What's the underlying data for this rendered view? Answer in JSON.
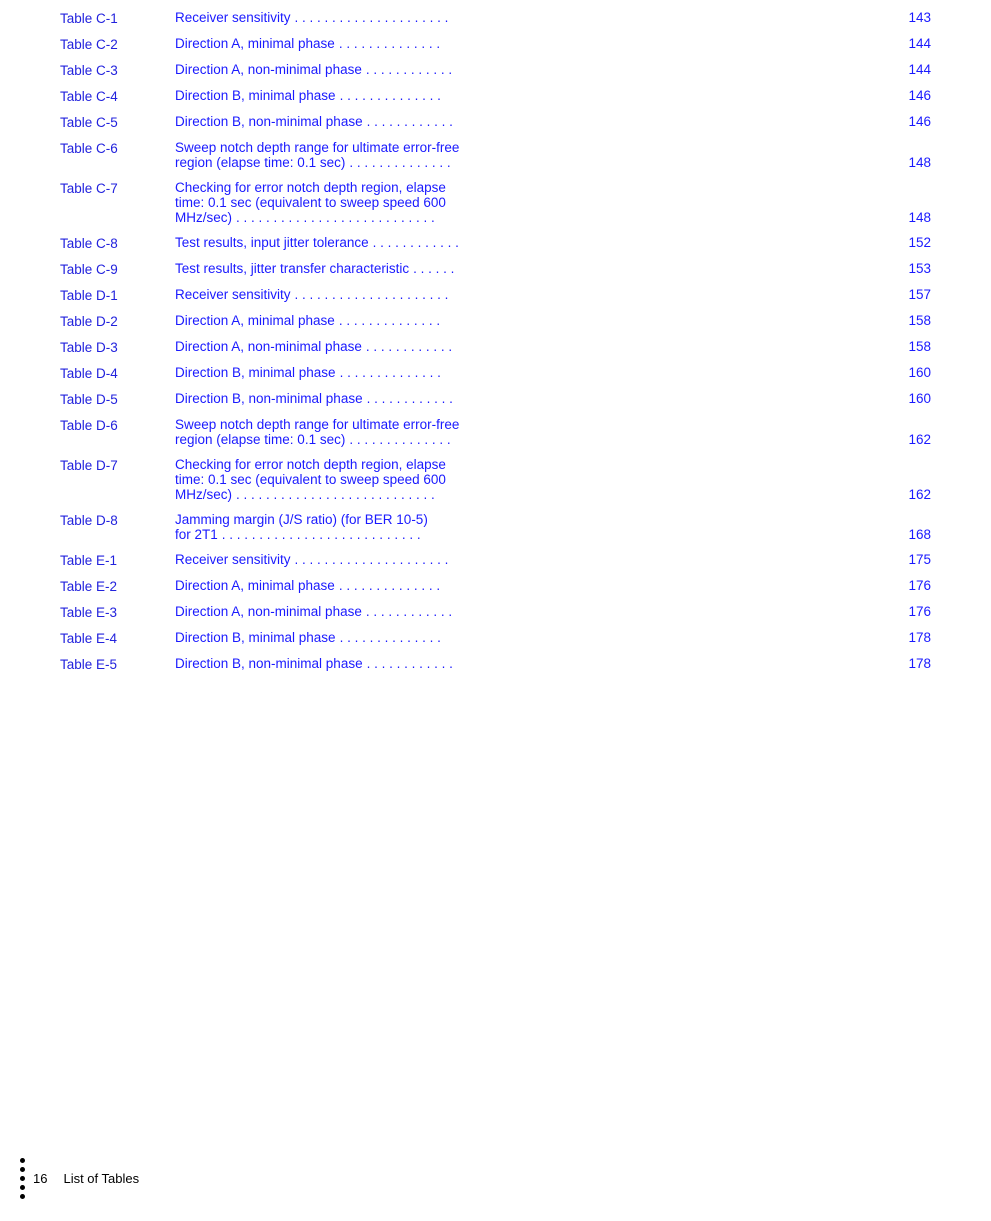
{
  "toc": {
    "entries": [
      {
        "id": "table-c-1",
        "label": "Table C-1",
        "title": "Receiver sensitivity",
        "dots": ". . . . . . . . . . . . . . . . . . . . .",
        "page": "143",
        "multiline": false
      },
      {
        "id": "table-c-2",
        "label": "Table C-2",
        "title": "Direction A, minimal phase",
        "dots": ". . . . . . . . . . . . . .",
        "page": "144",
        "multiline": false
      },
      {
        "id": "table-c-3",
        "label": "Table C-3",
        "title": "Direction A, non-minimal phase",
        "dots": ". . . . . . . . . . . .",
        "page": "144",
        "multiline": false
      },
      {
        "id": "table-c-4",
        "label": "Table C-4",
        "title": "Direction B, minimal phase",
        "dots": ". . . . . . . . . . . . . .",
        "page": "146",
        "multiline": false
      },
      {
        "id": "table-c-5",
        "label": "Table C-5",
        "title": "Direction B, non-minimal phase",
        "dots": ". . . . . . . . . . . .",
        "page": "146",
        "multiline": false
      },
      {
        "id": "table-c-6",
        "label": "Table C-6",
        "title_line1": "Sweep notch depth range for ultimate error-free",
        "title_line2": "region (elapse time: 0.1 sec)",
        "dots": ". . . . . . . . . . . . . .",
        "page": "148",
        "multiline": true
      },
      {
        "id": "table-c-7",
        "label": "Table C-7",
        "title_line1": "Checking for error notch depth region, elapse",
        "title_line2": "time: 0.1 sec (equivalent to sweep speed 600",
        "title_line3": "MHz/sec)",
        "dots": ". . . . . . . . . . . . . . . . . . . . . . . . . . .",
        "page": "148",
        "multiline": true,
        "lines": 3
      },
      {
        "id": "table-c-8",
        "label": "Table C-8",
        "title": "Test results, input jitter tolerance",
        "dots": ". . . . . . . . . . . .",
        "page": "152",
        "multiline": false
      },
      {
        "id": "table-c-9",
        "label": "Table C-9",
        "title": "Test results, jitter transfer characteristic",
        "dots": ". . . . . .",
        "page": "153",
        "multiline": false
      },
      {
        "id": "table-d-1",
        "label": "Table D-1",
        "title": "Receiver sensitivity",
        "dots": ". . . . . . . . . . . . . . . . . . . . .",
        "page": "157",
        "multiline": false
      },
      {
        "id": "table-d-2",
        "label": "Table D-2",
        "title": "Direction A, minimal phase",
        "dots": ". . . . . . . . . . . . . .",
        "page": "158",
        "multiline": false
      },
      {
        "id": "table-d-3",
        "label": "Table D-3",
        "title": "Direction A, non-minimal phase",
        "dots": ". . . . . . . . . . . .",
        "page": "158",
        "multiline": false
      },
      {
        "id": "table-d-4",
        "label": "Table D-4",
        "title": "Direction B, minimal phase",
        "dots": ". . . . . . . . . . . . . .",
        "page": "160",
        "multiline": false
      },
      {
        "id": "table-d-5",
        "label": "Table D-5",
        "title": "Direction B, non-minimal phase",
        "dots": ". . . . . . . . . . . .",
        "page": "160",
        "multiline": false
      },
      {
        "id": "table-d-6",
        "label": "Table D-6",
        "title_line1": "Sweep notch depth range for ultimate error-free",
        "title_line2": "region (elapse time: 0.1 sec)",
        "dots": ". . . . . . . . . . . . . .",
        "page": "162",
        "multiline": true
      },
      {
        "id": "table-d-7",
        "label": "Table D-7",
        "title_line1": "Checking for error notch depth region, elapse",
        "title_line2": "time: 0.1 sec (equivalent to sweep speed 600",
        "title_line3": "MHz/sec)",
        "dots": ". . . . . . . . . . . . . . . . . . . . . . . . . . .",
        "page": "162",
        "multiline": true,
        "lines": 3
      },
      {
        "id": "table-d-8",
        "label": "Table D-8",
        "title_line1": "Jamming margin (J/S ratio) (for BER 10-5)",
        "title_line2": "for 2T1",
        "dots": ". . . . . . . . . . . . . . . . . . . . . . . . . . .",
        "page": "168",
        "multiline": true
      },
      {
        "id": "table-e-1",
        "label": "Table E-1",
        "title": "Receiver sensitivity",
        "dots": ". . . . . . . . . . . . . . . . . . . . .",
        "page": "175",
        "multiline": false
      },
      {
        "id": "table-e-2",
        "label": "Table E-2",
        "title": "Direction A, minimal phase",
        "dots": ". . . . . . . . . . . . . .",
        "page": "176",
        "multiline": false
      },
      {
        "id": "table-e-3",
        "label": "Table E-3",
        "title": "Direction A, non-minimal phase",
        "dots": ". . . . . . . . . . . .",
        "page": "176",
        "multiline": false
      },
      {
        "id": "table-e-4",
        "label": "Table E-4",
        "title": "Direction B, minimal phase",
        "dots": ". . . . . . . . . . . . . .",
        "page": "178",
        "multiline": false
      },
      {
        "id": "table-e-5",
        "label": "Table E-5",
        "title": "Direction B, non-minimal phase",
        "dots": ". . . . . . . . . . . .",
        "page": "178",
        "multiline": false
      }
    ]
  },
  "footer": {
    "page_number": "16",
    "section_label": "List of Tables"
  }
}
